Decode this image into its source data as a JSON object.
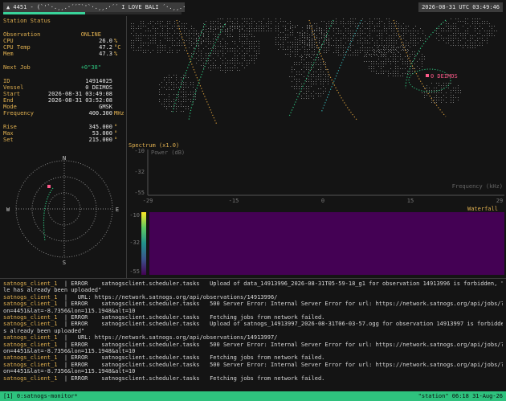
{
  "topbar": {
    "title": "▲ 4451 - (`'`·.¸¸.·´´¯`'`·.¸¸.·´´ I LOVE BALI ´·.¸¸.·´¯`'`·.¸¸.·´´¯)",
    "progress": 0.46,
    "clock": "2026-08-31 UTC 03:49:46"
  },
  "status": {
    "heading": "Station Status",
    "observation_label": "Observation",
    "observation_value": "ONLINE",
    "cpu_label": "CPU",
    "cpu_value": "26.0",
    "cpu_unit": "%",
    "cpu_temp_label": "CPU Temp",
    "cpu_temp_value": "47.2",
    "cpu_temp_unit": "°C",
    "mem_label": "Mem",
    "mem_value": "47.3",
    "mem_unit": "%",
    "next_job_label": "Next Job",
    "next_job_value": "+0\"38\"",
    "id_label": "ID",
    "id_value": "14914025",
    "vessel_label": "Vessel",
    "vessel_value": "0 DEIMOS",
    "start_label": "Start",
    "start_value": "2026-08-31 03:49:08",
    "end_label": "End",
    "end_value": "2026-08-31 03:52:08",
    "mode_label": "Mode",
    "mode_value": "GMSK",
    "freq_label": "Frequency",
    "freq_value": "400.300",
    "freq_unit": "MHz",
    "rise_label": "Rise",
    "rise_value": "345.000",
    "rise_unit": "°",
    "max_label": "Max",
    "max_value": "53.000",
    "max_unit": "°",
    "set_label": "Set",
    "set_value": "215.000",
    "set_unit": "°"
  },
  "map": {
    "satellite_label": "0 DEIMOS"
  },
  "polar": {
    "n": "N",
    "s": "S",
    "e": "E",
    "w": "W"
  },
  "spectrum": {
    "title": "Spectrum (x1.0)",
    "y_label": "Power (dB)",
    "x_label": "Frequency (kHz)",
    "y_ticks": [
      "-10",
      "-32",
      "-55"
    ],
    "x_ticks": [
      "-29",
      "-15",
      "0",
      "15",
      "29"
    ]
  },
  "waterfall": {
    "title": "Waterfall",
    "ticks": [
      "-10",
      "-32",
      "-55"
    ]
  },
  "log": [
    {
      "c": "satnogs_client_1",
      "t": "  | ERROR    satnogsclient.scheduler.tasks   Upload of data_14913996_2026-08-31T05-59-18_g1 for observation 14913996 is forbidden, \"This data fi"
    },
    {
      "c": "",
      "t": "le has already been uploaded\""
    },
    {
      "c": "satnogs_client_1",
      "t": "  |   URL: https://network.satnogs.org/api/observations/14913996/"
    },
    {
      "c": "satnogs_client_1",
      "t": "  | ERROR    satnogsclient.scheduler.tasks   500 Server Error: Internal Server Error for url: https://network.satnogs.org/api/jobs/?ground_stati"
    },
    {
      "c": "",
      "t": "on=4451&lat=-8.7356&lon=115.1948&alt=10"
    },
    {
      "c": "satnogs_client_1",
      "t": "  | ERROR    satnogsclient.scheduler.tasks   Fetching jobs from network failed."
    },
    {
      "c": "satnogs_client_1",
      "t": "  | ERROR    satnogsclient.scheduler.tasks   Upload of satnogs_14913997_2026-08-31T06-03-57.ogg for observation 14913997 is forbidden, \"Audio has"
    },
    {
      "c": "",
      "t": "s already been uploaded\""
    },
    {
      "c": "satnogs_client_1",
      "t": "  |   URL: https://network.satnogs.org/api/observations/14913997/"
    },
    {
      "c": "satnogs_client_1",
      "t": "  | ERROR    satnogsclient.scheduler.tasks   500 Server Error: Internal Server Error for url: https://network.satnogs.org/api/jobs/?ground_stati"
    },
    {
      "c": "",
      "t": "on=4451&lat=-8.7356&lon=115.1948&alt=10"
    },
    {
      "c": "satnogs_client_1",
      "t": "  | ERROR    satnogsclient.scheduler.tasks   Fetching jobs from network failed."
    },
    {
      "c": "satnogs_client_1",
      "t": "  | ERROR    satnogsclient.scheduler.tasks   500 Server Error: Internal Server Error for url: https://network.satnogs.org/api/jobs/?ground_stati"
    },
    {
      "c": "",
      "t": "on=4451&lat=-8.7356&lon=115.1948&alt=10"
    },
    {
      "c": "satnogs_client_1",
      "t": "  | ERROR    satnogsclient.scheduler.tasks   Fetching jobs from network failed."
    }
  ],
  "bottombar": {
    "session": "[1] 0:satnogs-monitor*",
    "right": "\"station\" 06:18 31-Aug-26"
  },
  "colors": {
    "accent": "#2ec27e",
    "label": "#e0b050",
    "waterfall_bg": "#440154",
    "pink": "#ff5a8a"
  }
}
